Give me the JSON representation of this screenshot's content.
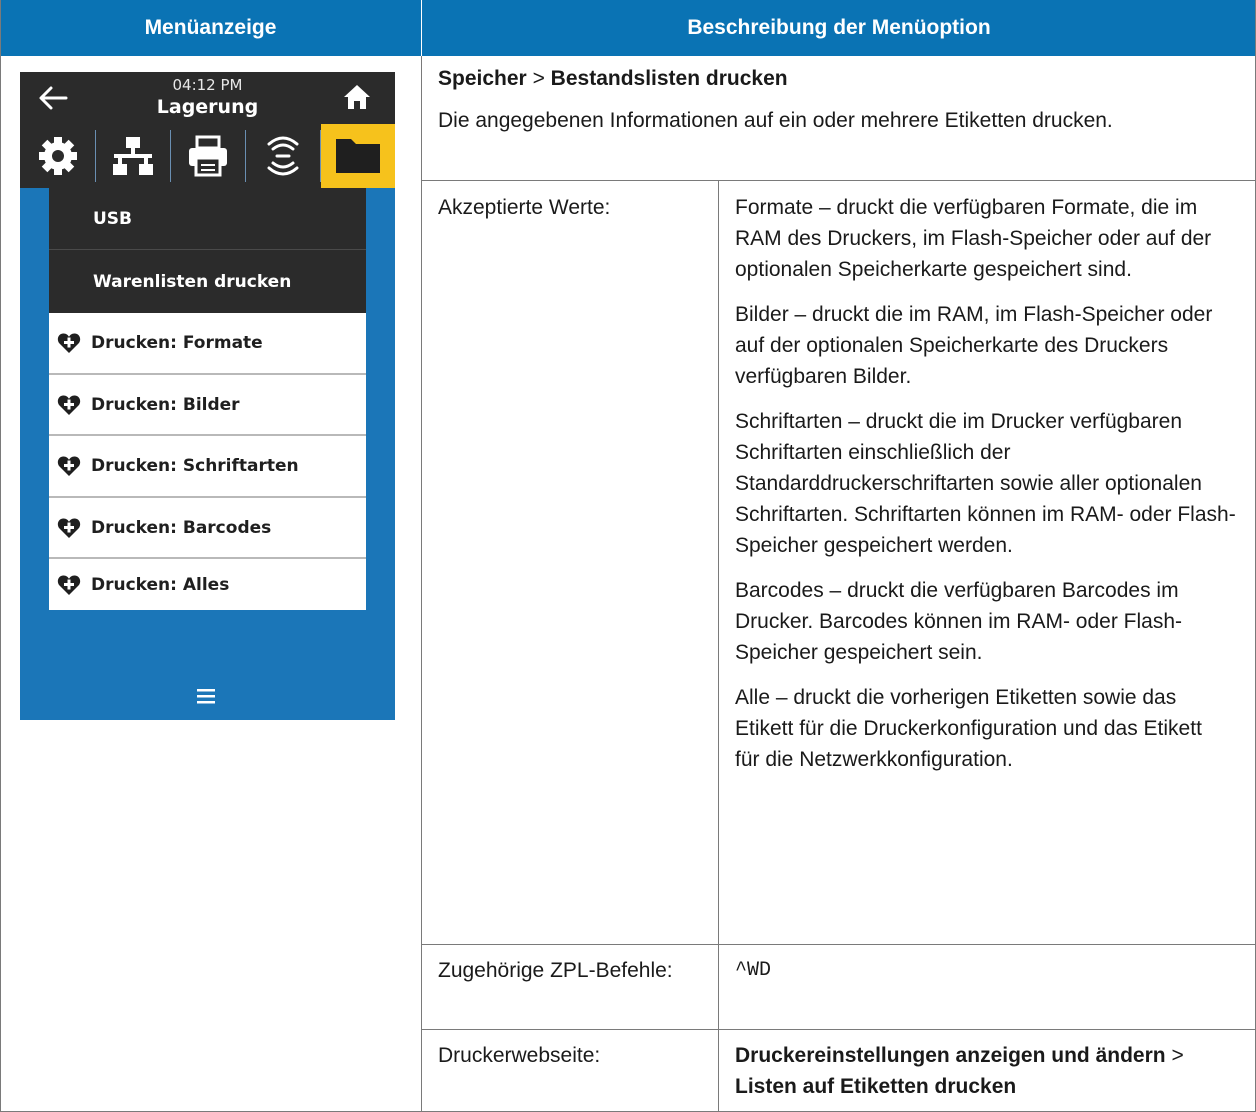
{
  "header": {
    "col1": "Menüanzeige",
    "col2": "Beschreibung der Menüoption"
  },
  "device": {
    "time": "04:12 PM",
    "title": "Lagerung",
    "back_icon": "arrow-left-icon",
    "home_icon": "home-icon",
    "tabs": [
      {
        "icon": "gear-icon"
      },
      {
        "icon": "network-icon"
      },
      {
        "icon": "printer-icon"
      },
      {
        "icon": "rfid-icon"
      },
      {
        "icon": "folder-icon",
        "active": true
      }
    ],
    "menu_items": [
      {
        "label": "USB",
        "style": "dark"
      },
      {
        "label": "Warenlisten drucken",
        "style": "dark"
      },
      {
        "label": "Drucken: Formate",
        "style": "light",
        "icon": "heart-plus-icon"
      },
      {
        "label": "Drucken: Bilder",
        "style": "light",
        "icon": "heart-plus-icon"
      },
      {
        "label": "Drucken: Schriftarten",
        "style": "light",
        "icon": "heart-plus-icon"
      },
      {
        "label": "Drucken: Barcodes",
        "style": "light",
        "icon": "heart-plus-icon"
      },
      {
        "label": "Drucken: Alles",
        "style": "light",
        "icon": "heart-plus-icon"
      }
    ],
    "menu_icon": "hamburger-menu-icon",
    "colors": {
      "screen_bg": "#1b76b8",
      "bar_bg": "#2b2b2b",
      "active_tab": "#f6c21c"
    }
  },
  "description": {
    "path_part1": "Speicher",
    "path_sep": ">",
    "path_part2": "Bestandslisten drucken",
    "text": "Die angegebenen Informationen auf ein oder mehrere Etiketten drucken."
  },
  "rows": {
    "accepted_label": "Akzeptierte Werte:",
    "accepted_values": [
      "Formate – druckt die verfügbaren Formate, die im RAM des Druckers, im Flash-Speicher oder auf der optionalen Speicherkarte gespeichert sind.",
      "Bilder – druckt die im RAM, im Flash-Speicher oder auf der optionalen Speicherkarte des Druckers verfügbaren Bilder.",
      "Schriftarten – druckt die im Drucker verfügbaren Schriftarten einschließlich der Standarddruckerschriftarten sowie aller optionalen Schriftarten. Schriftarten können im RAM- oder Flash-Speicher gespeichert werden.",
      "Barcodes – druckt die verfügbaren Barcodes im Drucker. Barcodes können im RAM- oder Flash-Speicher gespeichert sein.",
      "Alle – druckt die vorherigen Etiketten sowie das Etikett für die Druckerkonfiguration und das Etikett für die Netzwerkkonfiguration."
    ],
    "zpl_label": "Zugehörige ZPL-Befehle:",
    "zpl_value": "^WD",
    "web_label": "Druckerwebseite:",
    "web_part1": "Druckereinstellungen anzeigen und ändern",
    "web_sep": ">",
    "web_part2": "Listen auf Etiketten drucken"
  },
  "colors": {
    "header_bg": "#0a73b4",
    "border": "#7a7a7a"
  }
}
